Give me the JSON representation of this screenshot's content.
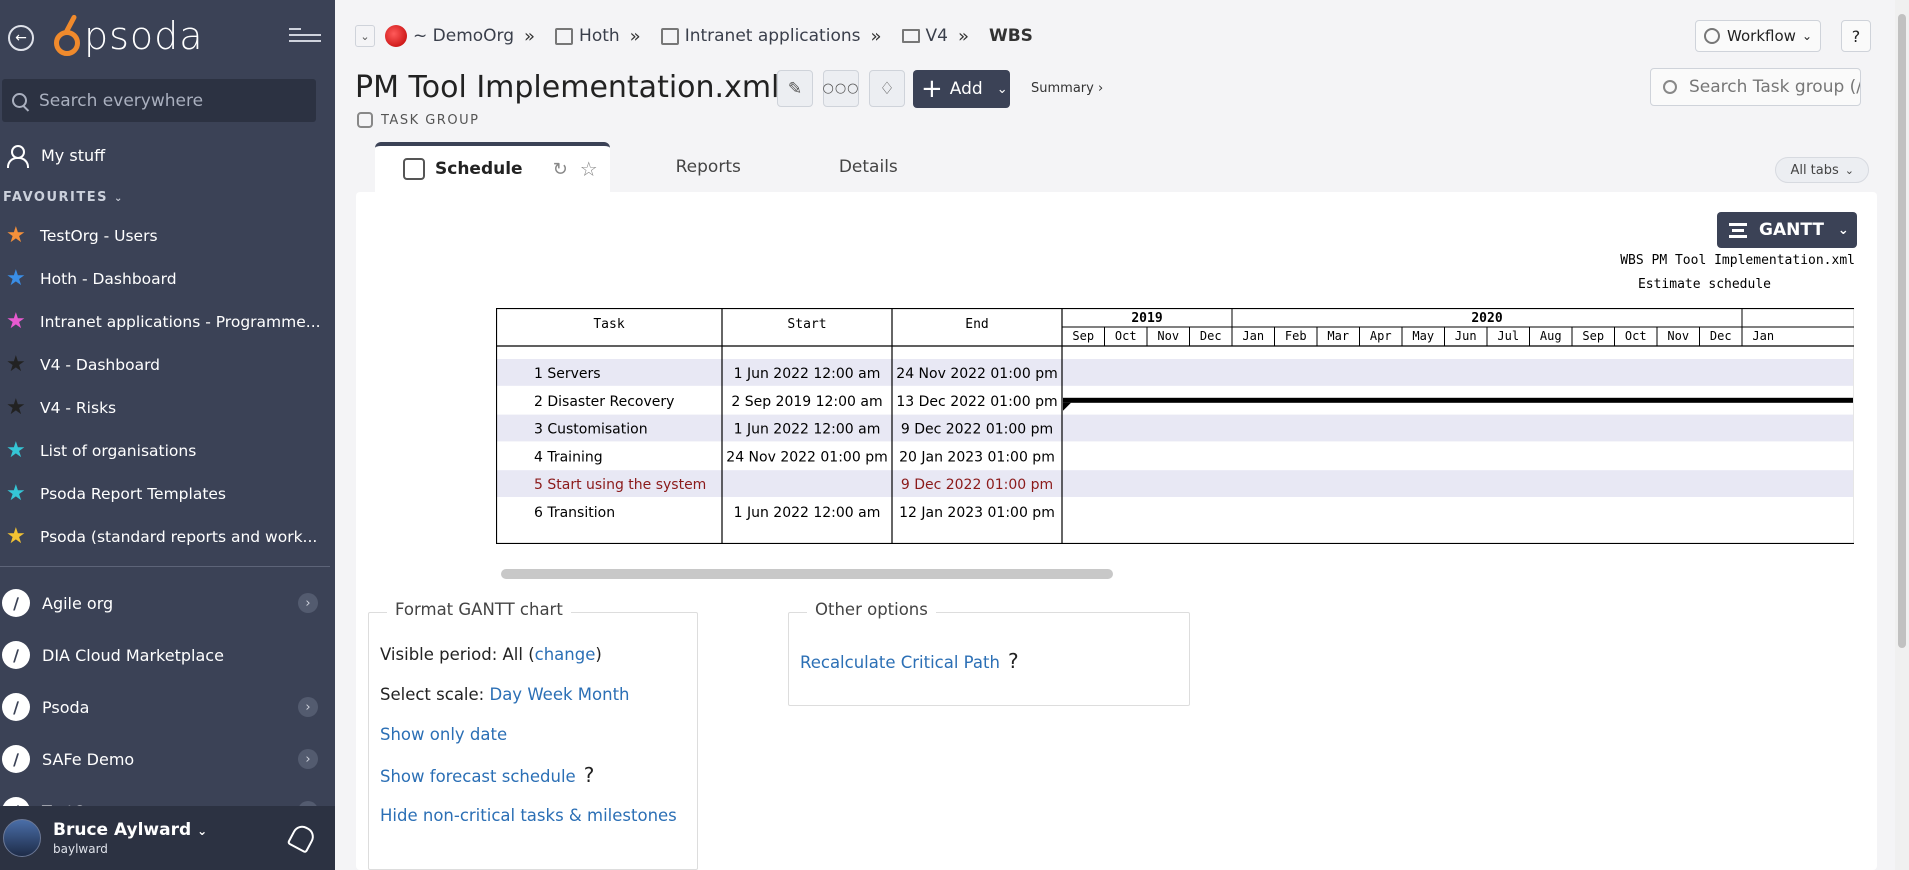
{
  "sidebar": {
    "brand": "psoda",
    "search_placeholder": "Search everywhere",
    "my_stuff": "My stuff",
    "favourites_label": "FAVOURITES",
    "favourites": [
      {
        "label": "TestOrg - Users",
        "color": "#f5903a"
      },
      {
        "label": "Hoth - Dashboard",
        "color": "#3a8ee6"
      },
      {
        "label": "Intranet applications - Programme...",
        "color": "#e85ad0"
      },
      {
        "label": "V4 - Dashboard",
        "color": "#222222"
      },
      {
        "label": "V4 - Risks",
        "color": "#222222"
      },
      {
        "label": "List of organisations",
        "color": "#35c6d6"
      },
      {
        "label": "Psoda Report Templates",
        "color": "#35c6d6"
      },
      {
        "label": "Psoda (standard reports and work...",
        "color": "#f2c233"
      }
    ],
    "organisations": [
      {
        "label": "Agile org",
        "has_children": true
      },
      {
        "label": "DIA Cloud Marketplace",
        "has_children": false
      },
      {
        "label": "Psoda",
        "has_children": true
      },
      {
        "label": "SAFe Demo",
        "has_children": true
      },
      {
        "label": "TestOrg",
        "has_children": true
      }
    ],
    "user": {
      "name": "Bruce Aylward",
      "login": "baylward"
    }
  },
  "breadcrumb": {
    "items": [
      "~ DemoOrg",
      "Hoth",
      "Intranet applications",
      "V4"
    ],
    "current": "WBS"
  },
  "toolbar": {
    "workflow": "Workflow",
    "help": "?",
    "add": "Add",
    "summary": "Summary ›",
    "search_placeholder": "Search Task group (/"
  },
  "page": {
    "title": "PM Tool Implementation.xml",
    "type_label": "TASK GROUP"
  },
  "tabs": [
    "Schedule",
    "Reports",
    "Details"
  ],
  "all_tabs": "All tabs",
  "gantt": {
    "button": "GANTT",
    "title_line1": "WBS PM Tool Implementation.xml",
    "title_line2": "Estimate schedule",
    "columns": [
      "Task",
      "Start",
      "End"
    ],
    "years": [
      "2019",
      "2020"
    ],
    "months": [
      "Sep",
      "Oct",
      "Nov",
      "Dec",
      "Jan",
      "Feb",
      "Mar",
      "Apr",
      "May",
      "Jun",
      "Jul",
      "Aug",
      "Sep",
      "Oct",
      "Nov",
      "Dec",
      "Jan"
    ],
    "rows": [
      {
        "task": "1 Servers",
        "start": "1 Jun 2022 12:00 am",
        "end": "24 Nov 2022 01:00 pm",
        "critical": false
      },
      {
        "task": "2 Disaster Recovery",
        "start": "2 Sep 2019 12:00 am",
        "end": "13 Dec 2022 01:00 pm",
        "critical": false,
        "summary_bar": true
      },
      {
        "task": "3 Customisation",
        "start": "1 Jun 2022 12:00 am",
        "end": "9 Dec 2022 01:00 pm",
        "critical": false
      },
      {
        "task": "4 Training",
        "start": "24 Nov 2022 01:00 pm",
        "end": "20 Jan 2023 01:00 pm",
        "critical": false
      },
      {
        "task": "5 Start using the system",
        "start": "",
        "end": "9 Dec 2022 01:00 pm",
        "critical": true
      },
      {
        "task": "6 Transition",
        "start": "1 Jun 2022 12:00 am",
        "end": "12 Jan 2023 01:00 pm",
        "critical": false
      }
    ],
    "colors": {
      "band": "#e8e8f4",
      "critical_text": "#8b1a1a"
    }
  },
  "format_panel": {
    "legend": "Format GANTT chart",
    "visible_period_label": "Visible period: All (",
    "visible_period_link": "change",
    "visible_period_close": ")",
    "scale_label": "Select scale:",
    "scale_day": "Day",
    "scale_week": "Week",
    "scale_month": "Month",
    "show_only_date": "Show only date",
    "show_forecast": "Show forecast schedule",
    "hide_noncritical": "Hide non-critical tasks & milestones"
  },
  "other_options": {
    "legend": "Other options",
    "recalc": "Recalculate Critical Path"
  }
}
